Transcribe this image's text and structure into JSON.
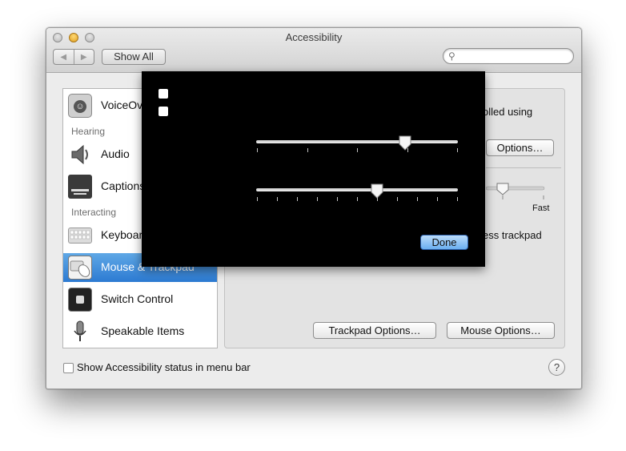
{
  "window": {
    "title": "Accessibility",
    "nav_back": "◀",
    "nav_forward": "▶",
    "show_all": "Show All",
    "search_placeholder": ""
  },
  "sidebar": {
    "items": [
      {
        "label": "VoiceOver",
        "icon": "voiceover-icon"
      },
      {
        "section": "Hearing"
      },
      {
        "label": "Audio",
        "icon": "speaker-icon"
      },
      {
        "label": "Captions",
        "icon": "captions-icon"
      },
      {
        "section": "Interacting"
      },
      {
        "label": "Keyboard",
        "icon": "keyboard-icon"
      },
      {
        "label": "Mouse & Trackpad",
        "icon": "mouse-trackpad-icon",
        "selected": true
      },
      {
        "label": "Switch Control",
        "icon": "switch-control-icon"
      },
      {
        "label": "Speakable Items",
        "icon": "microphone-icon"
      }
    ]
  },
  "content": {
    "partial_text_1": "olled using",
    "options_button": "Options…",
    "fast_label": "Fast",
    "partial_text_2": "ess trackpad",
    "trackpad_options_button": "Trackpad Options…",
    "mouse_options_button": "Mouse Options…"
  },
  "footer": {
    "show_status_label": "Show Accessibility status in menu bar",
    "help": "?"
  },
  "sheet": {
    "checkbox_1_checked": false,
    "checkbox_2_checked": false,
    "slider_1_value": 0.74,
    "slider_2_value": 0.6,
    "done_button": "Done"
  },
  "colors": {
    "selection": "#2c7ad2",
    "sheet_background": "#000000"
  }
}
